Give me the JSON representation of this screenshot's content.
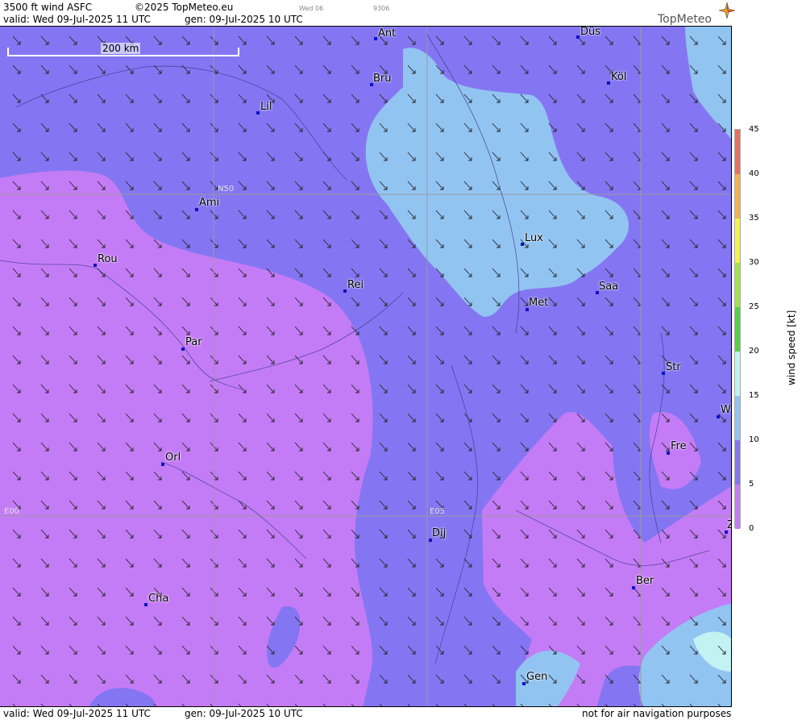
{
  "header": {
    "title": "3500 ft wind ASFC",
    "copyright": "©2025 TopMeteo.eu",
    "tab_day": "Wed 06",
    "tab_code": "9306",
    "valid": "valid:  Wed  09-Jul-2025  11 UTC",
    "generated": "gen: 09-Jul-2025 10 UTC",
    "brand": "TopMeteo"
  },
  "footer": {
    "valid": "valid:  Wed  09-Jul-2025  11 UTC",
    "generated": "gen: 09-Jul-2025 10 UTC",
    "disclaimer": "not for air navigation purposes"
  },
  "map": {
    "scale_label": "200 km",
    "grid_labels": {
      "lat50": "N50",
      "lon0": "E00",
      "lon5": "E05"
    },
    "cities": [
      {
        "name": "Ant"
      },
      {
        "name": "Düs"
      },
      {
        "name": "Bru"
      },
      {
        "name": "Köl"
      },
      {
        "name": "Lil"
      },
      {
        "name": "Ami"
      },
      {
        "name": "Lux"
      },
      {
        "name": "Rou"
      },
      {
        "name": "Rei"
      },
      {
        "name": "Saa"
      },
      {
        "name": "Met"
      },
      {
        "name": "Par"
      },
      {
        "name": "Str"
      },
      {
        "name": "W"
      },
      {
        "name": "Fre"
      },
      {
        "name": "Orl"
      },
      {
        "name": "Dij"
      },
      {
        "name": "Z"
      },
      {
        "name": "Ber"
      },
      {
        "name": "Cha"
      },
      {
        "name": "Gen"
      }
    ],
    "wind_direction": "from north-west"
  },
  "legend": {
    "title": "wind speed [kt]",
    "unit": "kt",
    "ticks": [
      "45",
      "40",
      "35",
      "30",
      "25",
      "20",
      "15",
      "10",
      "5",
      "0"
    ],
    "colors": {
      "0-5": "#c47cf6",
      "5-10": "#8476f2",
      "10-15": "#92c4f2",
      "15-20": "#c2f2f2",
      "20-25": "#52d24a",
      "25-30": "#a4e24a",
      "30-35": "#f4f24a",
      "35-40": "#f6b050",
      "40-45": "#ea7060"
    }
  }
}
